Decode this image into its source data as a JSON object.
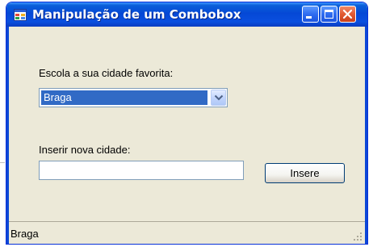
{
  "window": {
    "title": "Manipulação de um Combobox",
    "icon": "form-icon"
  },
  "title_buttons": {
    "minimize_icon": "minimize-icon",
    "maximize_icon": "maximize-icon",
    "close_icon": "close-icon"
  },
  "form": {
    "city_label": "Escola a sua cidade favorita:",
    "city_combo_value": "Braga",
    "new_city_label": "Inserir nova cidade:",
    "new_city_value": "",
    "insert_button_label": "Insere"
  },
  "status_bar": {
    "text": "Braga"
  },
  "colors": {
    "titlebar": "#0548d6",
    "selection": "#316ac5",
    "window_bg": "#ece9d8",
    "close_button": "#e15a32"
  }
}
